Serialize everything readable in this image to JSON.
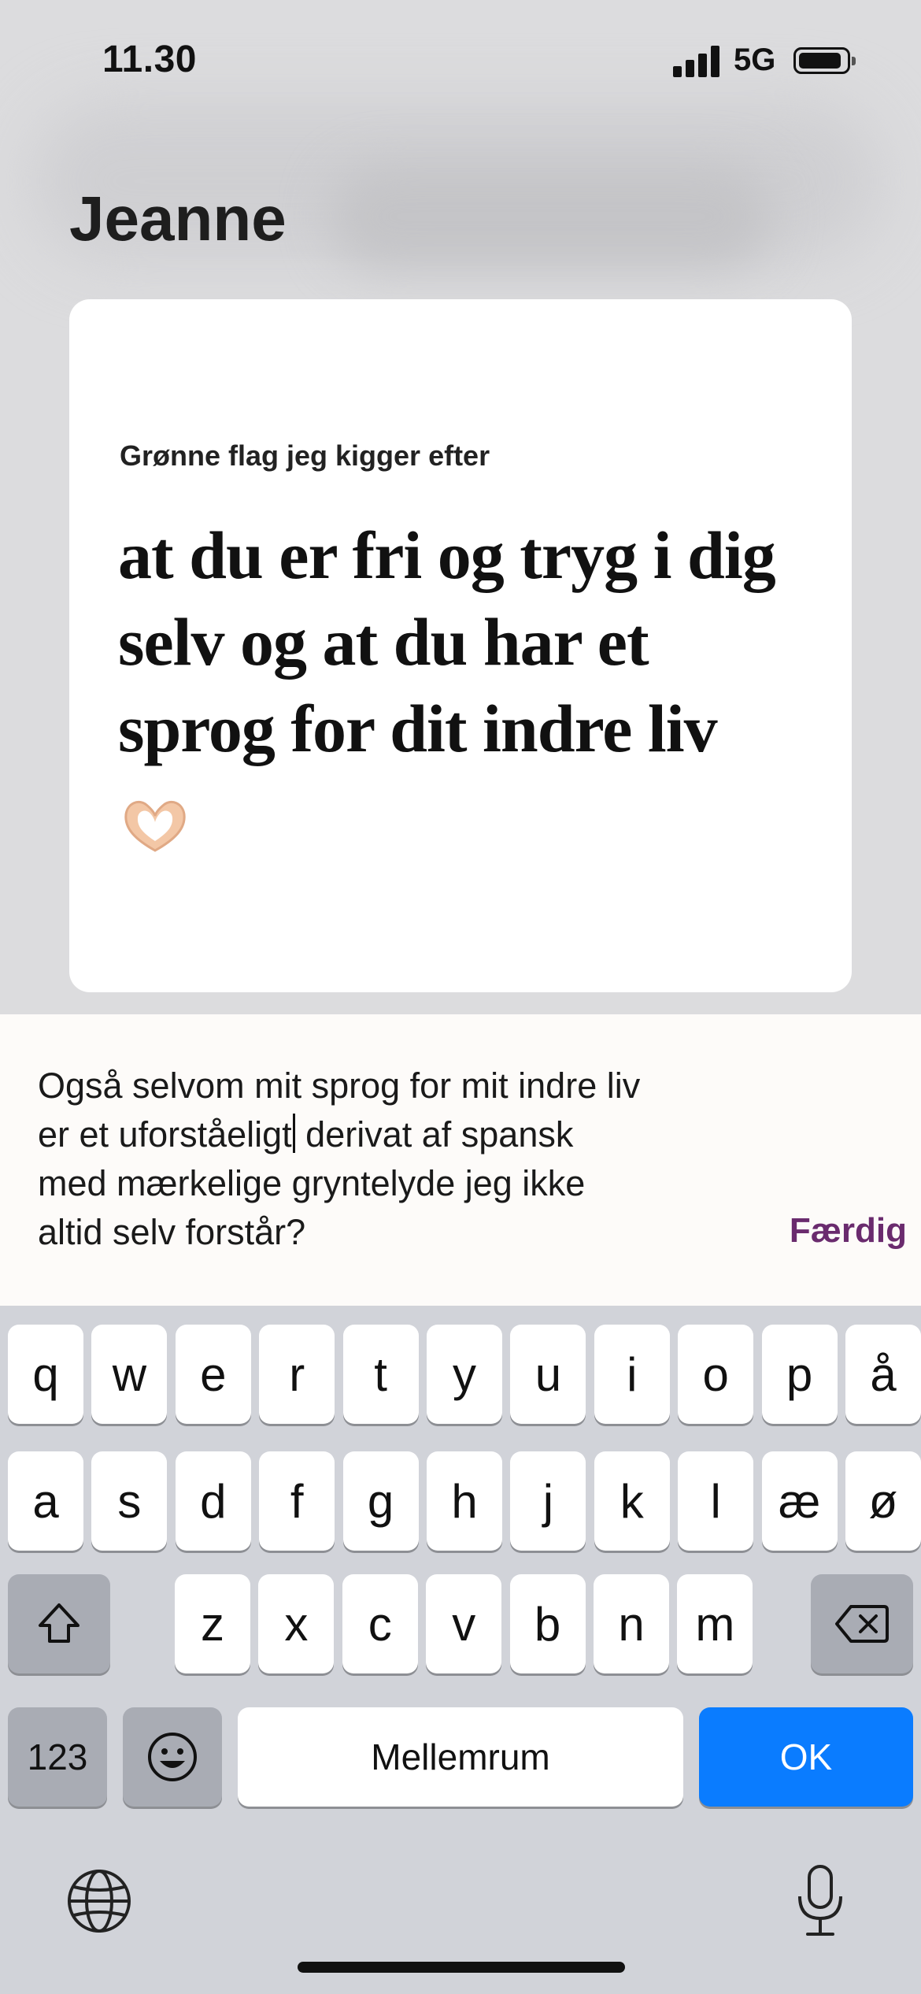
{
  "status_bar": {
    "time": "11.30",
    "network": "5G"
  },
  "profile": {
    "name": "Jeanne",
    "prompt_label": "Grønne flag jeg kigger efter",
    "answer_lines": [
      "at du er fri og tryg i dig",
      "selv og at du har et",
      "sprog for dit indre liv"
    ]
  },
  "input": {
    "text_before_caret": "Også selvom mit sprog for mit indre liv\ner et uforståeligt",
    "text_after_caret": " derivat af spansk\nmed mærkelige gryntelyde jeg ikke\naltid selv forstår?",
    "done_label": "Færdig"
  },
  "keyboard": {
    "row1": [
      "q",
      "w",
      "e",
      "r",
      "t",
      "y",
      "u",
      "i",
      "o",
      "p",
      "å"
    ],
    "row2": [
      "a",
      "s",
      "d",
      "f",
      "g",
      "h",
      "j",
      "k",
      "l",
      "æ",
      "ø"
    ],
    "row3": [
      "z",
      "x",
      "c",
      "v",
      "b",
      "n",
      "m"
    ],
    "numbers_label": "123",
    "space_label": "Mellemrum",
    "return_label": "OK"
  },
  "colors": {
    "accent": "#6a2b6e",
    "ok_key": "#0a7cff"
  }
}
